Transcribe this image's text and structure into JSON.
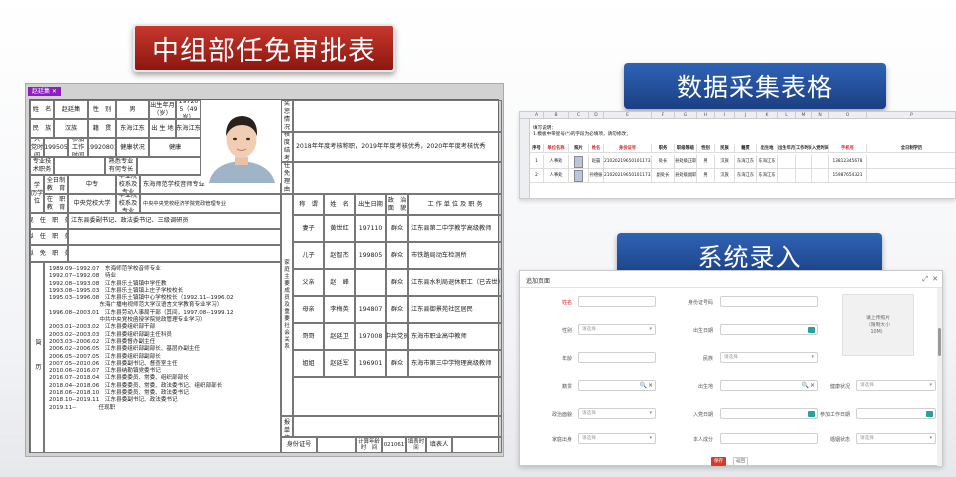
{
  "banners": {
    "approval": "中组部任免审批表",
    "collection": "数据采集表格",
    "entry": "系统录入"
  },
  "form": {
    "tab": "赵廷集",
    "labels": {
      "name": "姓　名",
      "gender": "性　别",
      "birth": "出生年月（岁）",
      "nation": "民　族",
      "origin": "籍　贯",
      "birthplace": "出 生 地",
      "party_date": "入　党时　间",
      "work_date": "参加工作时间",
      "health": "健康状况",
      "title": "专业技术职务",
      "specialty": "熟悉专业有何专长",
      "edu": "学　历学　位",
      "fulltime": "全日制教　育",
      "parttime": "在　职教　育",
      "school": "毕业院校系及专业",
      "cur_post": "现　任　职　务",
      "to_post": "拟　任　职　务",
      "to_remove": "拟　免　职　务",
      "resume": "简　历",
      "reward": "奖惩情况",
      "assess": "年核度结考果",
      "reason": "任免理由",
      "family": "家庭主要成员及重要社会关系",
      "opinion": "呈报单位",
      "id": "身份证号",
      "calc": "计算年龄时　间",
      "fill_time": "填表时间",
      "filler": "填表人"
    },
    "values": {
      "name": "赵廷集",
      "gender": "男",
      "birth": "197205（49岁）",
      "nation": "汉族",
      "origin": "东海江东",
      "birthplace": "东海江东",
      "party_date": "199505",
      "work_date": "19920801",
      "health": "健康",
      "fulltime_edu": "中专",
      "fulltime_school": "东海师范学校音师专业",
      "parttime_edu": "中央党校大学",
      "parttime_school": "中央中央党校经济学院党政管理专业",
      "cur_post": "江东县委副书记、政法委书记、三级调研员",
      "assess": "2018年年度考核称职，2019年年度考核优秀，2020年年度考核优秀",
      "calc_time": "20210617"
    },
    "family_headers": [
      "称　谓",
      "姓　名",
      "出生日期",
      "政　治面　貌",
      "工 作 单 位 及 职 务"
    ],
    "family": [
      [
        "妻子",
        "黄世红",
        "197110",
        "群众",
        "江东县第二中学教学高级教师"
      ],
      [
        "儿子",
        "赵智杰",
        "199805",
        "群众",
        "市铁路局动车检测所"
      ],
      [
        "父亲",
        "赵　峰",
        "",
        "群众",
        "江东县水利局退休职工（已去世）"
      ],
      [
        "母亲",
        "李梅英",
        "194807",
        "群众",
        "江东县御景苑社区居民"
      ],
      [
        "哥哥",
        "赵廷卫",
        "197008",
        "中共党员",
        "东海市职业高中教师"
      ],
      [
        "姐姐",
        "赵廷军",
        "196901",
        "群众",
        "东海市第三中学物理高级教师"
      ]
    ],
    "resume": "1989.09--1992.07　东海师范学校音师专业\n1992.07--1992.08　待业\n1992.08--1993.08　江东县乐土镇镇中学任教\n1993.08--1995.03　江东县乐土镇镇上庄子学校校长\n1995.03--1996.08　江东县乐土镇镇中心学校校长（1992.11--1996.02\n　　　　　　　　　东海广播电视师范大学汉语言文学教育专业学习）\n1996.08--2003.01　江东县劳动人事局干部（其间，1997.08--1999.12\n　　　　　　　　　中共中央党校函授学院党政管理专业学习）\n2003.01--2003.02　江东县委组织部干部\n2003.02--2003.03　江东县委组织部副主任科员\n2003.03--2006.02　江东县委督办副主任\n2006.02--2006.05　江东县委组织部副部长、基层办副主任\n2006.05--2007.05　江东县委组织部副部长\n2007.05--2010.06　江东县委副书记、督查室主任\n2010.06--2016.07　江东县纳勒镇党委书记\n2016.07--2018.04　江东县委委员、常委、组织部部长\n2018.04--2018.06　江东县委委员、常委、政法委书记、组织部部长\n2018.06--2018.10　江东县委委员、常委、政法委书记\n2018.10--2019.11　江东县委副书记、政法委书记\n2019.11--　　　　任现职"
  },
  "sheet": {
    "columns": [
      "A",
      "B",
      "C",
      "D",
      "E",
      "F",
      "G",
      "H",
      "I",
      "J",
      "K",
      "L",
      "M",
      "N",
      "O",
      "P"
    ],
    "notes": "填写说明：\n1.模板中带星号(*)的字段为必填项，请勿修改；",
    "headers": [
      "序号",
      "单位名称",
      "照片",
      "姓名",
      "身份证号",
      "职务",
      "职级等级",
      "性别",
      "民族",
      "籍贯",
      "出生地",
      "出生年月",
      "工作时间",
      "入党时间",
      "手机号",
      "全日制学历"
    ],
    "rows": [
      [
        "1",
        "人事处",
        "",
        "赵晨",
        "210202196501011732",
        "处长",
        "县处级正职",
        "男",
        "汉族",
        "东海江东",
        "东海江东",
        "",
        "",
        "",
        "13812345678",
        ""
      ],
      [
        "2",
        "人事处",
        "",
        "孙德振",
        "210202196501011732",
        "副处长",
        "县处级副职",
        "男",
        "汉族",
        "东海江东",
        "东海江东",
        "",
        "",
        "",
        "15987654321",
        ""
      ]
    ]
  },
  "dialog": {
    "title": "追加页面",
    "fields": {
      "name": "姓名",
      "id": "身份证号码",
      "gender": "性别",
      "birth": "出生日期",
      "age": "年龄",
      "nation": "民族",
      "origin": "籍贯",
      "birthplace": "出生地",
      "health": "健康状况",
      "party": "政治面貌",
      "join_date": "入党日期",
      "work_date": "参加工作日期",
      "family_origin": "家庭出身",
      "personal": "本人成分",
      "marriage": "婚姻状态"
    },
    "placeholder": "请选择",
    "upload": "请上传照片\n（限制大小\n10M）",
    "save": "保存",
    "back": "返回"
  }
}
